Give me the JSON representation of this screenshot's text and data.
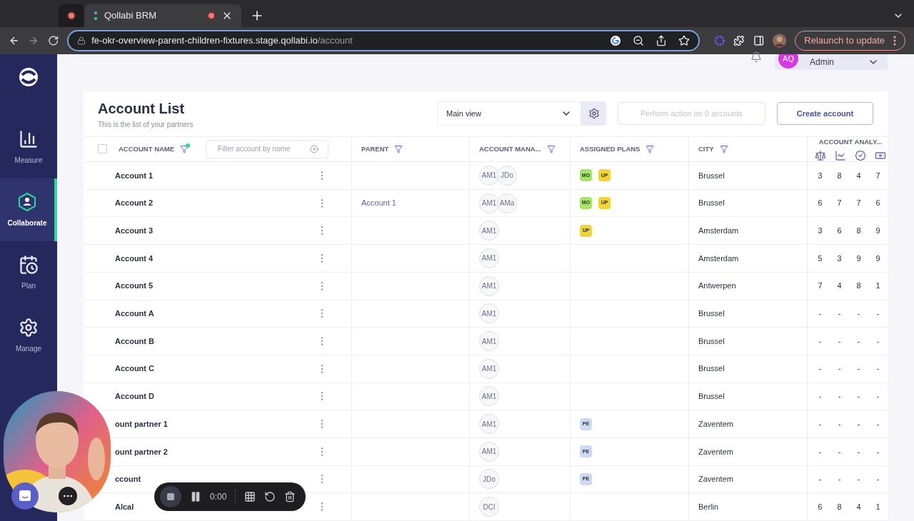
{
  "browser": {
    "tabs": [
      {
        "selected": false,
        "recording": true
      },
      {
        "title": "Qollabi BRM",
        "selected": true,
        "recording": true
      }
    ],
    "url_host": "fe-okr-overview-parent-children-fixtures.stage.qollabi.io",
    "url_path": "/account",
    "relaunch_button": "Relaunch to update"
  },
  "sidebar": {
    "items": [
      {
        "label": "Measure",
        "kind": "chart",
        "selected": false
      },
      {
        "label": "Collaborate",
        "kind": "team",
        "selected": true
      },
      {
        "label": "Plan",
        "kind": "calendar",
        "selected": false
      },
      {
        "label": "Manage",
        "kind": "gear",
        "selected": false
      }
    ]
  },
  "user": {
    "initials": "AQ",
    "name": "Admin"
  },
  "page": {
    "title": "Account List",
    "subtitle": "This is the list of your partners",
    "view_select": "Main view",
    "action_button": {
      "label": "Perform action on 0 accounts",
      "disabled": true
    },
    "create_button": "Create account"
  },
  "table": {
    "select_all_checked": false,
    "name_filter_active": true,
    "filter_placeholder": "Filter account by name",
    "columns": [
      "ACCOUNT NAME",
      "PARENT",
      "ACCOUNT MANA...",
      "ASSIGNED PLANS",
      "CITY",
      "ACCOUNT ANALY..."
    ],
    "rows": [
      {
        "name": "Account 1",
        "parent": "",
        "managers": [
          "AM1",
          "JDo"
        ],
        "plans": [
          {
            "code": "MO",
            "color": "#a6e36b"
          },
          {
            "code": "UP",
            "color": "#f0d43a"
          }
        ],
        "city": "Brussel",
        "scores": [
          "3",
          "8",
          "4",
          "7"
        ]
      },
      {
        "name": "Account 2",
        "parent": "Account 1",
        "managers": [
          "AM1",
          "AMa"
        ],
        "plans": [
          {
            "code": "MO",
            "color": "#a6e36b"
          },
          {
            "code": "UP",
            "color": "#f0d43a"
          }
        ],
        "city": "Brussel",
        "scores": [
          "6",
          "7",
          "7",
          "6"
        ]
      },
      {
        "name": "Account 3",
        "parent": "",
        "managers": [
          "AM1"
        ],
        "plans": [
          {
            "code": "UP",
            "color": "#f0d43a"
          }
        ],
        "city": "Amsterdam",
        "scores": [
          "3",
          "6",
          "8",
          "9"
        ]
      },
      {
        "name": "Account 4",
        "parent": "",
        "managers": [
          "AM1"
        ],
        "plans": [],
        "city": "Amsterdam",
        "scores": [
          "5",
          "3",
          "9",
          "9"
        ]
      },
      {
        "name": "Account 5",
        "parent": "",
        "managers": [
          "AM1"
        ],
        "plans": [],
        "city": "Antwerpen",
        "scores": [
          "7",
          "4",
          "8",
          "1"
        ]
      },
      {
        "name": "Account A",
        "parent": "",
        "managers": [
          "AM1"
        ],
        "plans": [],
        "city": "Brussel",
        "scores": [
          "-",
          "-",
          "-",
          "-"
        ]
      },
      {
        "name": "Account B",
        "parent": "",
        "managers": [
          "AM1"
        ],
        "plans": [],
        "city": "Brussel",
        "scores": [
          "-",
          "-",
          "-",
          "-"
        ]
      },
      {
        "name": "Account C",
        "parent": "",
        "managers": [
          "AM1"
        ],
        "plans": [],
        "city": "Brussel",
        "scores": [
          "-",
          "-",
          "-",
          "-"
        ]
      },
      {
        "name": "Account D",
        "parent": "",
        "managers": [
          "AM1"
        ],
        "plans": [],
        "city": "Brussel",
        "scores": [
          "-",
          "-",
          "-",
          "-"
        ]
      },
      {
        "name": "ount partner 1",
        "parent": "",
        "managers": [
          "AM1"
        ],
        "plans": [
          {
            "code": "PE",
            "color": "#cfdaf0"
          }
        ],
        "city": "Zaventem",
        "scores": [
          "-",
          "-",
          "-",
          "-"
        ]
      },
      {
        "name": "ount partner 2",
        "parent": "",
        "managers": [
          "AM1"
        ],
        "plans": [
          {
            "code": "PE",
            "color": "#cfdaf0"
          }
        ],
        "city": "Zaventem",
        "scores": [
          "-",
          "-",
          "-",
          "-"
        ]
      },
      {
        "name": "ccount",
        "parent": "",
        "managers": [
          "JDo"
        ],
        "plans": [
          {
            "code": "PE",
            "color": "#cfdaf0"
          }
        ],
        "city": "Zaventem",
        "scores": [
          "-",
          "-",
          "-",
          "-"
        ]
      },
      {
        "name": "Alcal",
        "parent": "",
        "managers": [
          "DCI"
        ],
        "plans": [],
        "city": "Berlin",
        "scores": [
          "6",
          "8",
          "4",
          "1"
        ]
      }
    ]
  },
  "recorder": {
    "time": "0:00"
  }
}
